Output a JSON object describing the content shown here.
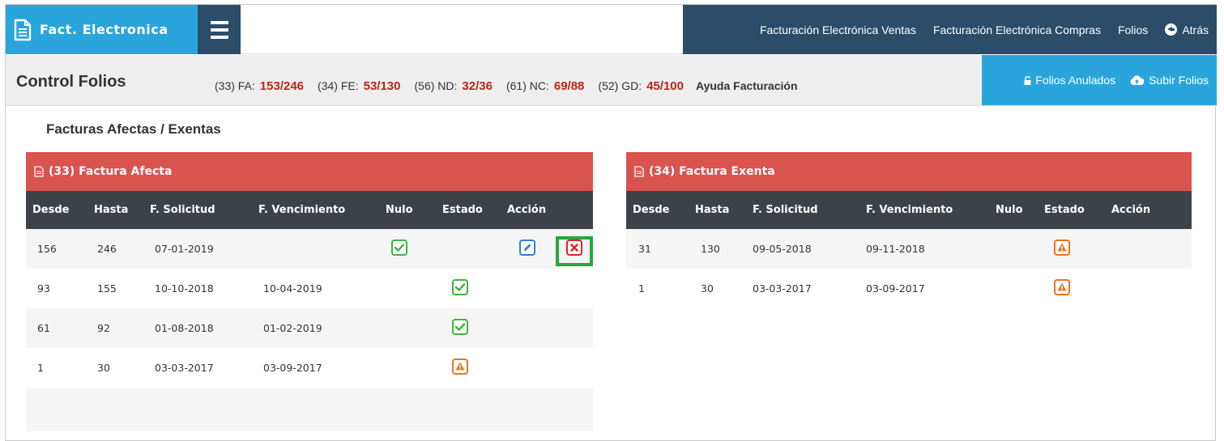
{
  "brand": {
    "title": "Fact. Electronica",
    "icon": "document-icon"
  },
  "topnav": {
    "items": [
      "Facturación Electrónica Ventas",
      "Facturación Electrónica Compras",
      "Folios",
      "Atrás"
    ]
  },
  "control": {
    "title": "Control Folios",
    "counters": [
      {
        "label": "(33) FA:",
        "value": "153/246"
      },
      {
        "label": "(34) FE:",
        "value": "53/130"
      },
      {
        "label": "(56) ND:",
        "value": "32/36"
      },
      {
        "label": "(61) NC:",
        "value": "69/88"
      },
      {
        "label": "(52) GD:",
        "value": "45/100"
      }
    ],
    "help": "Ayuda Facturación",
    "actions": [
      "Folios Anulados",
      "Subir Folios"
    ]
  },
  "section": {
    "title": "Facturas Afectas / Exentas"
  },
  "left_table": {
    "title": "(33) Factura Afecta",
    "columns": [
      "Desde",
      "Hasta",
      "F. Solicitud",
      "F. Vencimiento",
      "Nulo",
      "Estado",
      "Acción"
    ],
    "rows": [
      {
        "desde": "156",
        "hasta": "246",
        "solicitud": "07-01-2019",
        "vencimiento": "",
        "nulo": "check",
        "estado": "",
        "accion": [
          "edit",
          "delete"
        ]
      },
      {
        "desde": "93",
        "hasta": "155",
        "solicitud": "10-10-2018",
        "vencimiento": "10-04-2019",
        "nulo": "",
        "estado": "check",
        "accion": []
      },
      {
        "desde": "61",
        "hasta": "92",
        "solicitud": "01-08-2018",
        "vencimiento": "01-02-2019",
        "nulo": "",
        "estado": "check",
        "accion": []
      },
      {
        "desde": "1",
        "hasta": "30",
        "solicitud": "03-03-2017",
        "vencimiento": "03-09-2017",
        "nulo": "",
        "estado": "warning",
        "accion": []
      }
    ]
  },
  "right_table": {
    "title": "(34) Factura Exenta",
    "columns": [
      "Desde",
      "Hasta",
      "F. Solicitud",
      "F. Vencimiento",
      "Nulo",
      "Estado",
      "Acción"
    ],
    "rows": [
      {
        "desde": "31",
        "hasta": "130",
        "solicitud": "09-05-2018",
        "vencimiento": "09-11-2018",
        "nulo": "",
        "estado": "warning"
      },
      {
        "desde": "1",
        "hasta": "30",
        "solicitud": "03-03-2017",
        "vencimiento": "03-09-2017",
        "nulo": "",
        "estado": "warning"
      }
    ]
  },
  "colors": {
    "brand": "#2aa5dc",
    "nav": "#2b4d6a",
    "panel_head": "#d9534f",
    "table_head": "#3c4247",
    "counter_value": "#b8261b",
    "ok": "#3cb43c",
    "warn": "#f0701e",
    "edit": "#2f7fd6",
    "delete": "#d9262c",
    "highlight": "#27a739"
  }
}
